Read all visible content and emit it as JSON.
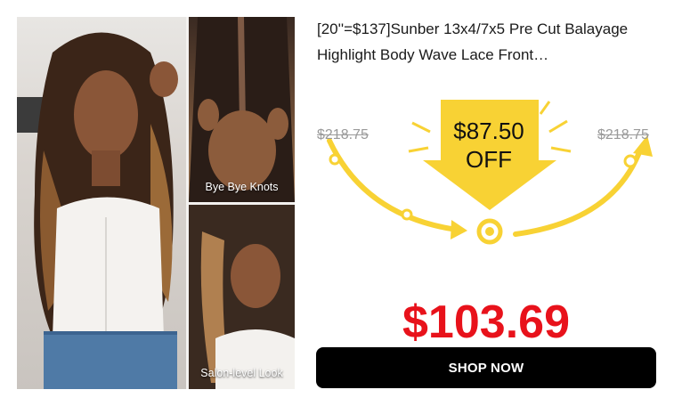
{
  "product": {
    "title": "[20''=$137]Sunber 13x4/7x5 Pre Cut Balayage Highlight Body Wave Lace Front…"
  },
  "gallery": {
    "captions": [
      "Bye Bye Knots",
      "Salon-level Look"
    ]
  },
  "pricing": {
    "original_price_left": "$218.75",
    "original_price_right": "$218.75",
    "discount_amount": "$87.50",
    "discount_suffix": "OFF",
    "final_price": "$103.69"
  },
  "cta": {
    "label": "SHOP NOW"
  },
  "colors": {
    "accent_yellow": "#f8d234",
    "price_red": "#e8121b",
    "button_black": "#000000"
  }
}
